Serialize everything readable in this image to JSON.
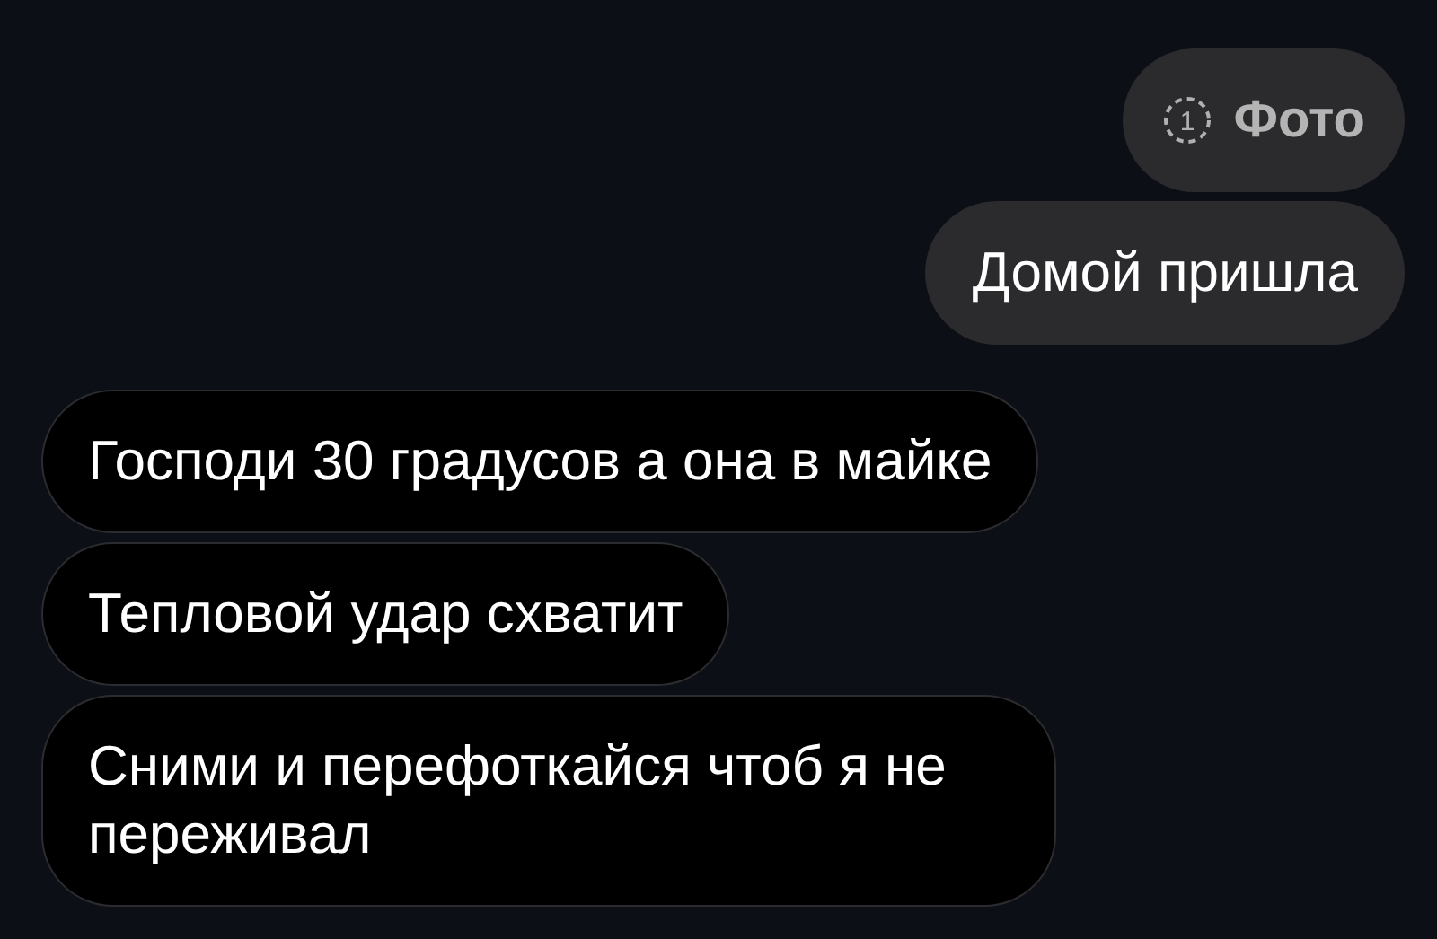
{
  "messages": [
    {
      "kind": "photo",
      "outgoing": true,
      "count": "1",
      "text": "Фото"
    },
    {
      "kind": "text",
      "outgoing": true,
      "text": "Домой пришла"
    },
    {
      "kind": "text",
      "outgoing": false,
      "text": "Господи 30 градусов а она в майке"
    },
    {
      "kind": "text",
      "outgoing": false,
      "text": "Тепловой удар схватит"
    },
    {
      "kind": "text",
      "outgoing": false,
      "text": "Сними и перефоткайся чтоб я не переживал"
    }
  ]
}
